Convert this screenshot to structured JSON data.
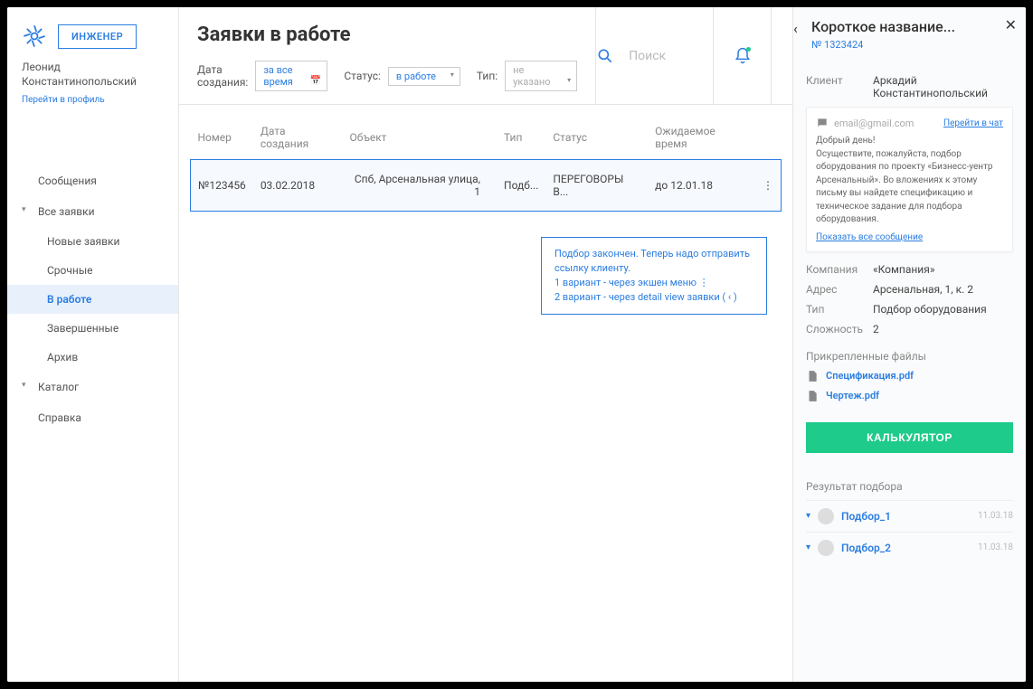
{
  "sidebar": {
    "role": "ИНЖЕНЕР",
    "user_name": "Леонид Константинопольский",
    "profile_link": "Перейти в профиль",
    "nav": {
      "messages": "Сообщения",
      "all_requests": "Все заявки",
      "subs": [
        "Новые заявки",
        "Срочные",
        "В работе",
        "Завершенные",
        "Архив"
      ],
      "catalog": "Каталог",
      "help": "Справка"
    }
  },
  "header": {
    "title": "Заявки в работе",
    "filters": {
      "created_label": "Дата создания:",
      "created_value": "за все время",
      "status_label": "Статус:",
      "status_value": "в работе",
      "type_label": "Тип:",
      "type_value": "не указано"
    },
    "search_placeholder": "Поиск"
  },
  "table": {
    "cols": [
      "Номер",
      "Дата создания",
      "Объект",
      "Тип",
      "Статус",
      "Ожидаемое время"
    ],
    "row": {
      "number": "№123456",
      "date": "03.02.2018",
      "object": "Спб, Арсенальная улица, 1",
      "type": "Подб...",
      "status": "ПЕРЕГОВОРЫ В...",
      "expected": "до 12.01.18"
    }
  },
  "hint": {
    "l1": "Подбор закончен. Теперь надо отправить ссылку клиенту.",
    "l2": "1 вариант - через экшен меню  ⋮",
    "l3": "2 вариант - через detail view заявки ( ‹ )"
  },
  "detail": {
    "title": "Короткое название...",
    "number": "№ 1323424",
    "client_label": "Клиент",
    "client_value": "Аркадий Константинопольский",
    "msg": {
      "email": "email@gmail.com",
      "goto_chat": "Перейти в чат",
      "greeting": "Добрый день!",
      "body": "Осуществите, пожалуйста, подбор оборудования по проекту «Бизнесс-уентр Арсенальный». Во вложениях к этому письму вы найдете спецификацию и техническое задание для подбора оборудования.",
      "show_all": "Показать все сообщение"
    },
    "company_label": "Компания",
    "company_value": "«Компания»",
    "address_label": "Адрес",
    "address_value": "Арсенальная, 1, к. 2",
    "type_label": "Тип",
    "type_value": "Подбор оборудования",
    "difficulty_label": "Сложность",
    "difficulty_value": "2",
    "files_title": "Прикрепленные файлы",
    "files": [
      "Спецификация.pdf",
      "Чертеж.pdf"
    ],
    "calc_button": "КАЛЬКУЛЯТОР",
    "results_title": "Результат подбора",
    "results": [
      {
        "name": "Подбор_1",
        "date": "11.03.18"
      },
      {
        "name": "Подбор_2",
        "date": "11.03.18"
      }
    ]
  }
}
